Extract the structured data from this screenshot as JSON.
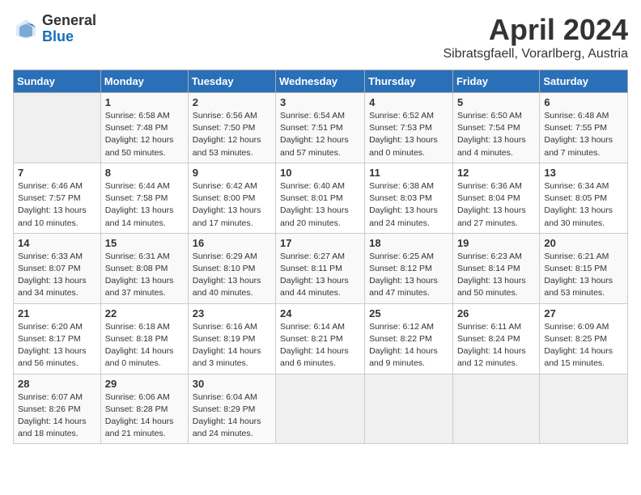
{
  "header": {
    "logo_general": "General",
    "logo_blue": "Blue",
    "title": "April 2024",
    "subtitle": "Sibratsgfaell, Vorarlberg, Austria"
  },
  "days_of_week": [
    "Sunday",
    "Monday",
    "Tuesday",
    "Wednesday",
    "Thursday",
    "Friday",
    "Saturday"
  ],
  "weeks": [
    [
      {
        "day": "",
        "detail": ""
      },
      {
        "day": "1",
        "detail": "Sunrise: 6:58 AM\nSunset: 7:48 PM\nDaylight: 12 hours\nand 50 minutes."
      },
      {
        "day": "2",
        "detail": "Sunrise: 6:56 AM\nSunset: 7:50 PM\nDaylight: 12 hours\nand 53 minutes."
      },
      {
        "day": "3",
        "detail": "Sunrise: 6:54 AM\nSunset: 7:51 PM\nDaylight: 12 hours\nand 57 minutes."
      },
      {
        "day": "4",
        "detail": "Sunrise: 6:52 AM\nSunset: 7:53 PM\nDaylight: 13 hours\nand 0 minutes."
      },
      {
        "day": "5",
        "detail": "Sunrise: 6:50 AM\nSunset: 7:54 PM\nDaylight: 13 hours\nand 4 minutes."
      },
      {
        "day": "6",
        "detail": "Sunrise: 6:48 AM\nSunset: 7:55 PM\nDaylight: 13 hours\nand 7 minutes."
      }
    ],
    [
      {
        "day": "7",
        "detail": "Sunrise: 6:46 AM\nSunset: 7:57 PM\nDaylight: 13 hours\nand 10 minutes."
      },
      {
        "day": "8",
        "detail": "Sunrise: 6:44 AM\nSunset: 7:58 PM\nDaylight: 13 hours\nand 14 minutes."
      },
      {
        "day": "9",
        "detail": "Sunrise: 6:42 AM\nSunset: 8:00 PM\nDaylight: 13 hours\nand 17 minutes."
      },
      {
        "day": "10",
        "detail": "Sunrise: 6:40 AM\nSunset: 8:01 PM\nDaylight: 13 hours\nand 20 minutes."
      },
      {
        "day": "11",
        "detail": "Sunrise: 6:38 AM\nSunset: 8:03 PM\nDaylight: 13 hours\nand 24 minutes."
      },
      {
        "day": "12",
        "detail": "Sunrise: 6:36 AM\nSunset: 8:04 PM\nDaylight: 13 hours\nand 27 minutes."
      },
      {
        "day": "13",
        "detail": "Sunrise: 6:34 AM\nSunset: 8:05 PM\nDaylight: 13 hours\nand 30 minutes."
      }
    ],
    [
      {
        "day": "14",
        "detail": "Sunrise: 6:33 AM\nSunset: 8:07 PM\nDaylight: 13 hours\nand 34 minutes."
      },
      {
        "day": "15",
        "detail": "Sunrise: 6:31 AM\nSunset: 8:08 PM\nDaylight: 13 hours\nand 37 minutes."
      },
      {
        "day": "16",
        "detail": "Sunrise: 6:29 AM\nSunset: 8:10 PM\nDaylight: 13 hours\nand 40 minutes."
      },
      {
        "day": "17",
        "detail": "Sunrise: 6:27 AM\nSunset: 8:11 PM\nDaylight: 13 hours\nand 44 minutes."
      },
      {
        "day": "18",
        "detail": "Sunrise: 6:25 AM\nSunset: 8:12 PM\nDaylight: 13 hours\nand 47 minutes."
      },
      {
        "day": "19",
        "detail": "Sunrise: 6:23 AM\nSunset: 8:14 PM\nDaylight: 13 hours\nand 50 minutes."
      },
      {
        "day": "20",
        "detail": "Sunrise: 6:21 AM\nSunset: 8:15 PM\nDaylight: 13 hours\nand 53 minutes."
      }
    ],
    [
      {
        "day": "21",
        "detail": "Sunrise: 6:20 AM\nSunset: 8:17 PM\nDaylight: 13 hours\nand 56 minutes."
      },
      {
        "day": "22",
        "detail": "Sunrise: 6:18 AM\nSunset: 8:18 PM\nDaylight: 14 hours\nand 0 minutes."
      },
      {
        "day": "23",
        "detail": "Sunrise: 6:16 AM\nSunset: 8:19 PM\nDaylight: 14 hours\nand 3 minutes."
      },
      {
        "day": "24",
        "detail": "Sunrise: 6:14 AM\nSunset: 8:21 PM\nDaylight: 14 hours\nand 6 minutes."
      },
      {
        "day": "25",
        "detail": "Sunrise: 6:12 AM\nSunset: 8:22 PM\nDaylight: 14 hours\nand 9 minutes."
      },
      {
        "day": "26",
        "detail": "Sunrise: 6:11 AM\nSunset: 8:24 PM\nDaylight: 14 hours\nand 12 minutes."
      },
      {
        "day": "27",
        "detail": "Sunrise: 6:09 AM\nSunset: 8:25 PM\nDaylight: 14 hours\nand 15 minutes."
      }
    ],
    [
      {
        "day": "28",
        "detail": "Sunrise: 6:07 AM\nSunset: 8:26 PM\nDaylight: 14 hours\nand 18 minutes."
      },
      {
        "day": "29",
        "detail": "Sunrise: 6:06 AM\nSunset: 8:28 PM\nDaylight: 14 hours\nand 21 minutes."
      },
      {
        "day": "30",
        "detail": "Sunrise: 6:04 AM\nSunset: 8:29 PM\nDaylight: 14 hours\nand 24 minutes."
      },
      {
        "day": "",
        "detail": ""
      },
      {
        "day": "",
        "detail": ""
      },
      {
        "day": "",
        "detail": ""
      },
      {
        "day": "",
        "detail": ""
      }
    ]
  ]
}
